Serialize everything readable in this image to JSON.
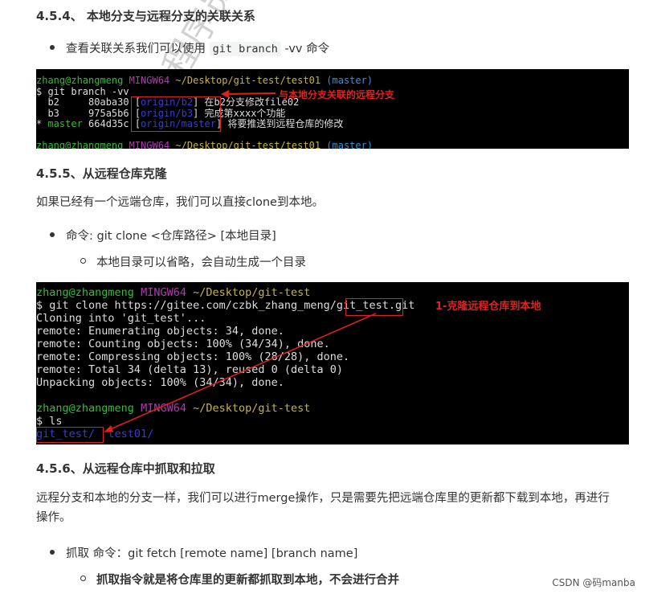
{
  "s454": {
    "heading": "4.5.4、 本地分支与远程分支的关联关系",
    "bullet_pre": "查看关联关系我们可以使用 ",
    "bullet_code": "git branch",
    "bullet_post": " -vv 命令"
  },
  "term1": {
    "prompt_user": "zhang@zhangmeng",
    "prompt_sys": "MINGW64",
    "prompt_path": "~/Desktop/git-test/test01",
    "prompt_branch": "(master)",
    "cmd": "$ git branch -vv",
    "rows": [
      {
        "pre": "  b2     80aba30 [",
        "remote": "origin/b2",
        "post": "] 在b2分支修改file02"
      },
      {
        "pre": "  b3     975a5b6 [",
        "remote": "origin/b3",
        "post": "] 完成第xxxx个功能"
      },
      {
        "star": "* ",
        "name": "master",
        "pre": " 664d35c [",
        "remote": "origin/master",
        "post": "] 将要推送到远程仓库的修改"
      }
    ],
    "annotation": "与本地分支关联的远程分支"
  },
  "s455": {
    "heading": "4.5.5、从远程仓库克隆",
    "para": "如果已经有一个远端仓库，我们可以直接clone到本地。",
    "bullet": "命令: git clone <仓库路径> [本地目录]",
    "sub_bullet": "本地目录可以省略，会自动生成一个目录"
  },
  "term2": {
    "prompt_user": "zhang@zhangmeng",
    "prompt_sys": "MINGW64",
    "prompt_path": "~/Desktop/git-test",
    "cmd_pre": "$ git clone https://gitee.com/czbk_zhang_meng/",
    "cmd_box": "git_test",
    "cmd_post": ".git",
    "lines": [
      "Cloning into 'git_test'...",
      "remote: Enumerating objects: 34, done.",
      "remote: Counting objects: 100% (34/34), done.",
      "remote: Compressing objects: 100% (28/28), done.",
      "remote: Total 34 (delta 13), reused 0 (delta 0)",
      "Unpacking objects: 100% (34/34), done."
    ],
    "cmd2": "$ ls",
    "dir1": "git_test/",
    "dir2": "test01/",
    "annotation": "1-克隆远程仓库到本地"
  },
  "s456": {
    "heading": "4.5.6、从远程仓库中抓取和拉取",
    "para": "远程分支和本地的分支一样，我们可以进行merge操作，只是需要先把远端仓库里的更新都下载到本地，再进行操作。",
    "bullet": "抓取 命令：git fetch [remote name] [branch name]",
    "sub_bullet": "抓取指令就是将仓库里的更新都抓取到本地，不会进行合并"
  },
  "watermark": "黑马程序员 北京",
  "csdn": "CSDN @码manba"
}
